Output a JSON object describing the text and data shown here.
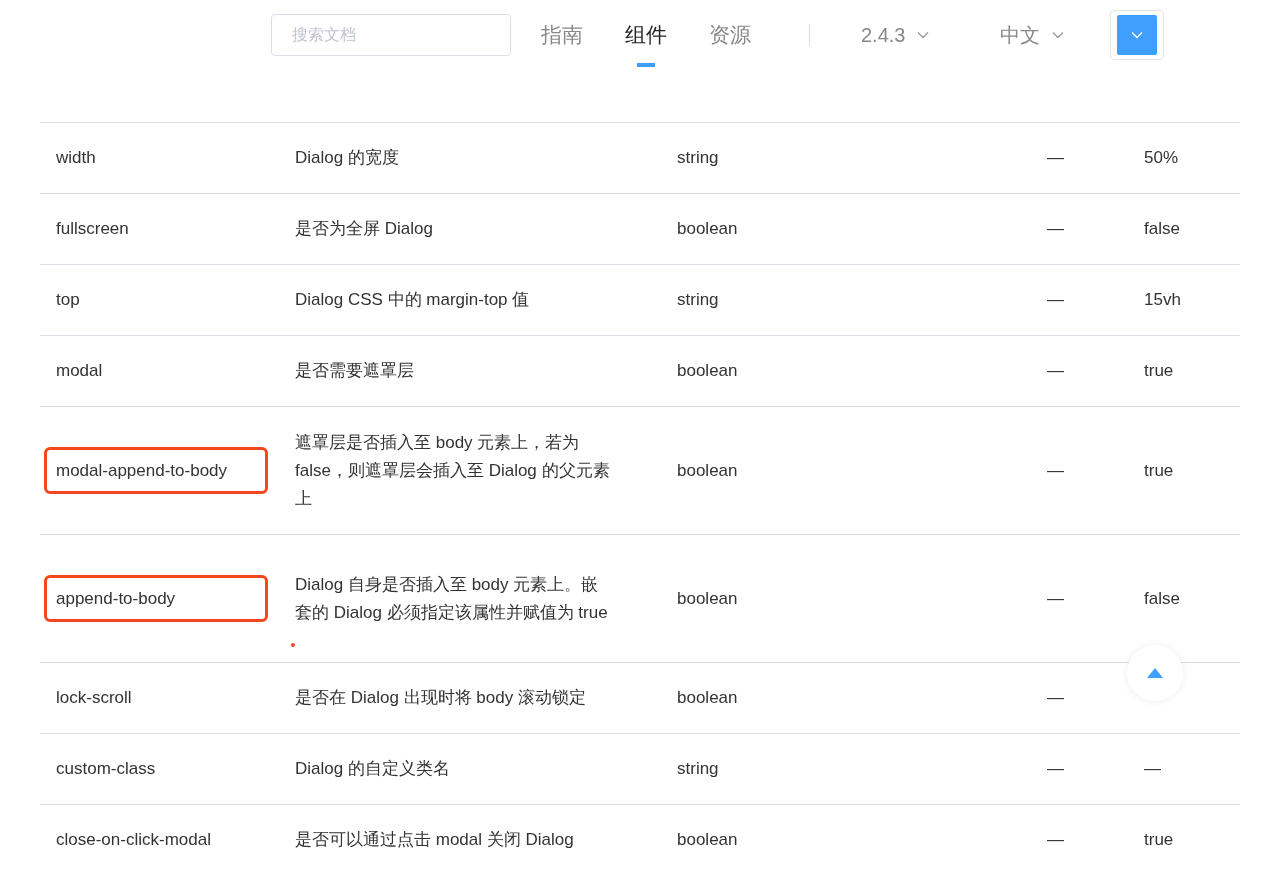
{
  "header": {
    "search": {
      "placeholder": "搜索文档"
    },
    "nav": [
      {
        "label": "指南",
        "selected": false
      },
      {
        "label": "组件",
        "selected": true
      },
      {
        "label": "资源",
        "selected": false
      }
    ],
    "version": "2.4.3",
    "language": "中文"
  },
  "table": {
    "rows": [
      {
        "name": "width",
        "description": "Dialog 的宽度",
        "type": "string",
        "options": "—",
        "default": "50%",
        "highlighted": false
      },
      {
        "name": "fullscreen",
        "description": "是否为全屏 Dialog",
        "type": "boolean",
        "options": "—",
        "default": "false",
        "highlighted": false
      },
      {
        "name": "top",
        "description": "Dialog CSS 中的 margin-top 值",
        "type": "string",
        "options": "—",
        "default": "15vh",
        "highlighted": false
      },
      {
        "name": "modal",
        "description": "是否需要遮罩层",
        "type": "boolean",
        "options": "—",
        "default": "true",
        "highlighted": false
      },
      {
        "name": "modal-append-to-body",
        "description": "遮罩层是否插入至 body 元素上，若为 false，则遮罩层会插入至 Dialog 的父元素上",
        "type": "boolean",
        "options": "—",
        "default": "true",
        "highlighted": true
      },
      {
        "name": "append-to-body",
        "description": "Dialog 自身是否插入至 body 元素上。嵌套的 Dialog 必须指定该属性并赋值为 true",
        "type": "boolean",
        "options": "—",
        "default": "false",
        "highlighted": true
      },
      {
        "name": "lock-scroll",
        "description": "是否在 Dialog 出现时将 body 滚动锁定",
        "type": "boolean",
        "options": "—",
        "highlighted": false
      },
      {
        "name": "custom-class",
        "description": "Dialog 的自定义类名",
        "type": "string",
        "options": "—",
        "default": "—",
        "highlighted": false
      },
      {
        "name": "close-on-click-modal",
        "description": "是否可以通过点击 modal 关闭 Dialog",
        "type": "boolean",
        "options": "—",
        "default": "true",
        "highlighted": false
      }
    ]
  }
}
